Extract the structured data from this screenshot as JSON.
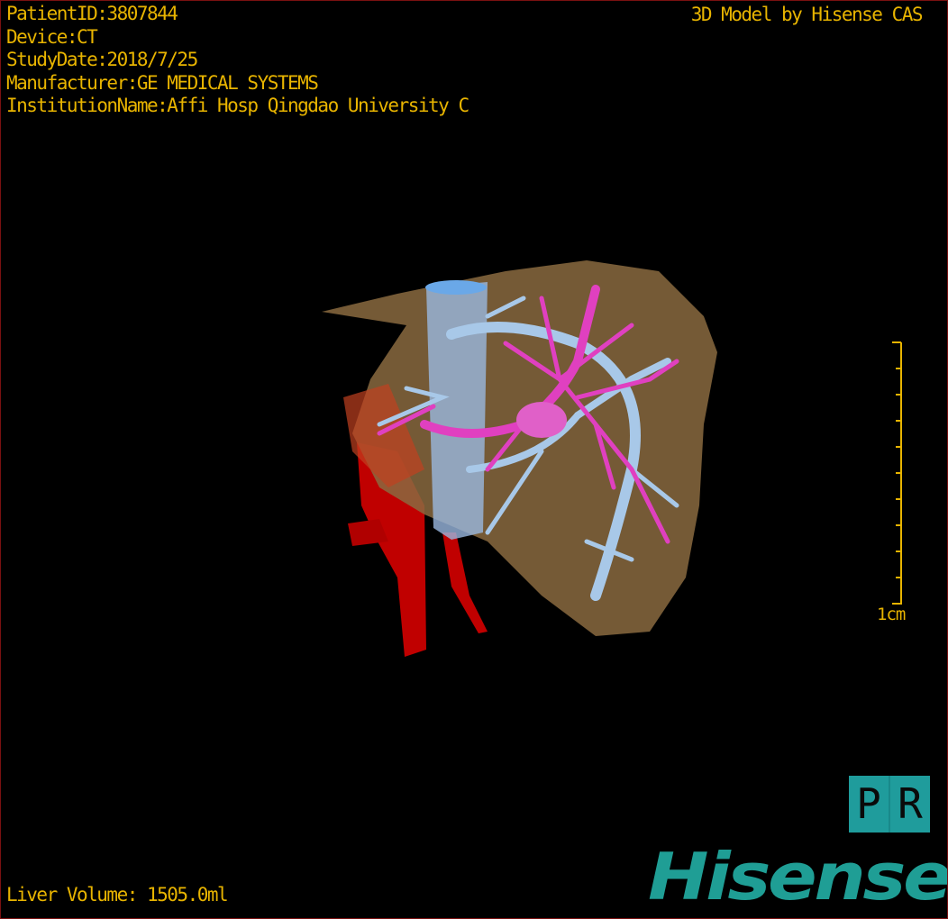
{
  "info": {
    "patient_id": "PatientID:3807844",
    "device": "Device:CT",
    "study_date": "StudyDate:2018/7/25",
    "manufacturer": "Manufacturer:GE MEDICAL SYSTEMS",
    "institution": "InstitutionName:Affi Hosp Qingdao University C"
  },
  "credit": "3D Model by Hisense CAS",
  "liver_volume": "Liver Volume: 1505.0ml",
  "scale_bar": {
    "label": "1cm"
  },
  "orientation": {
    "left": "P",
    "right": "R"
  },
  "logo": "Hisense",
  "colors": {
    "text": "#e8b400",
    "liver": "#8a6a40",
    "portal_vein": "#e040c0",
    "hepatic_vein": "#a8c8e8",
    "ivc": "#6aa8e8",
    "artery": "#c80000",
    "brand": "#1f9e95"
  }
}
